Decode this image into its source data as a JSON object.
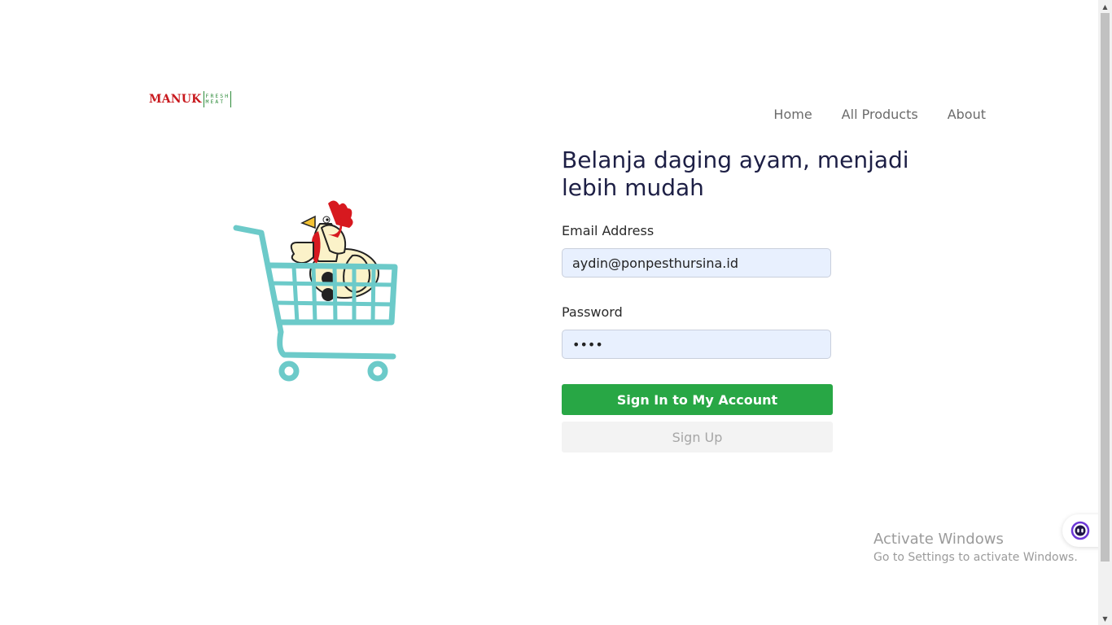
{
  "brand": {
    "name": "MANUK",
    "sub1": "FRESH",
    "sub2": "MEAT"
  },
  "nav": [
    {
      "label": "Home"
    },
    {
      "label": "All Products"
    },
    {
      "label": "About"
    }
  ],
  "hero": {
    "icon": "chicken-in-shopping-cart"
  },
  "main": {
    "title": "Belanja daging ayam, menjadi lebih mudah",
    "email_label": "Email Address",
    "email_value": "aydin@ponpesthursina.id",
    "password_label": "Password",
    "password_value": "••••",
    "signin_label": "Sign In to My Account",
    "signup_label": "Sign Up"
  },
  "watermark": {
    "title": "Activate Windows",
    "subtitle": "Go to Settings to activate Windows."
  },
  "colors": {
    "primary": "#28a745",
    "brand_red": "#c8181d",
    "brand_green": "#2e8b3a",
    "cart": "#6ccac9"
  }
}
